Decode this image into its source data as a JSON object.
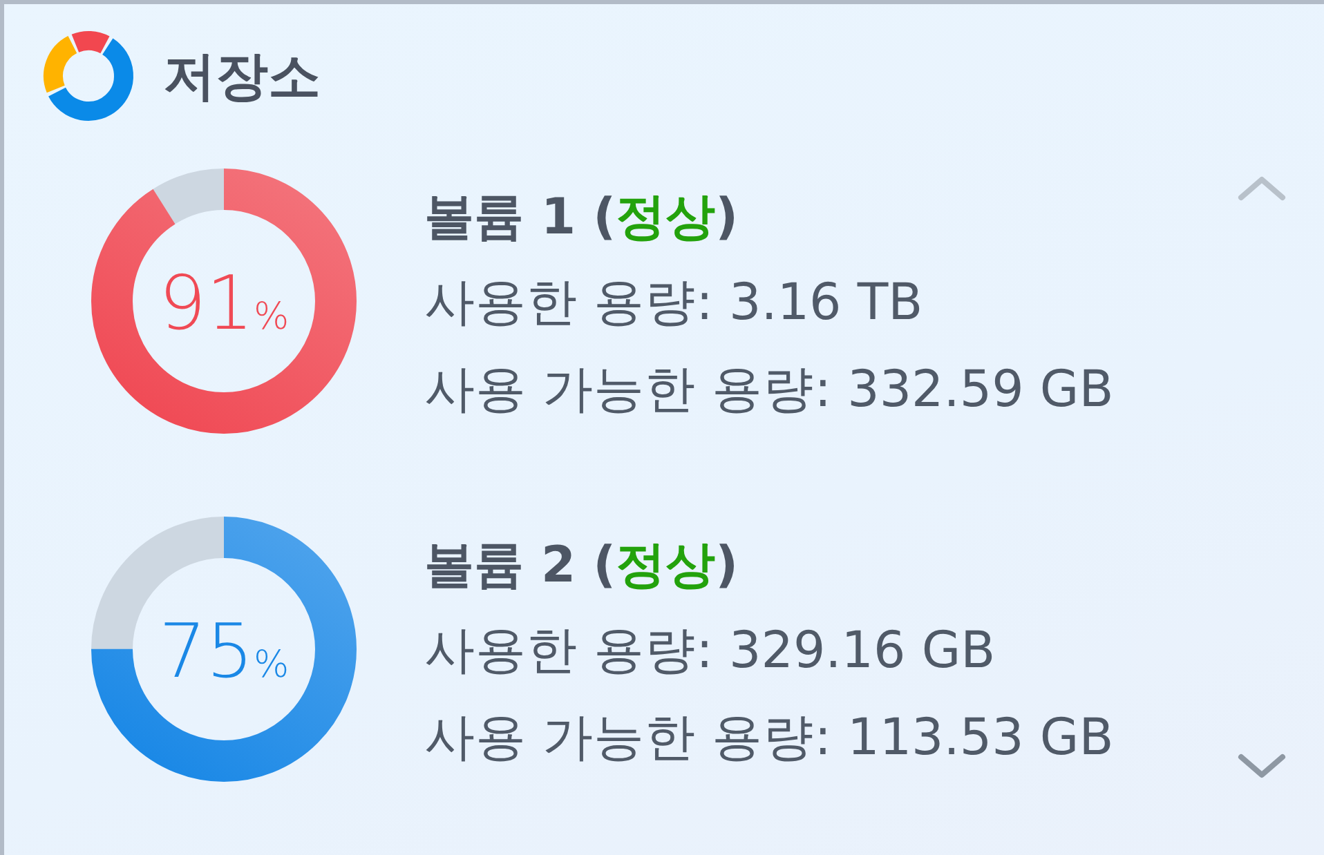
{
  "widget": {
    "title": "저장소"
  },
  "volumes": [
    {
      "name": "볼륨 1",
      "status": {
        "open": "(",
        "text": "정상",
        "close": ")"
      },
      "level": 0.91,
      "percent": "91",
      "unit": "%",
      "color": "#f04a55",
      "used": "사용한 용량: 3.16 TB",
      "available": "사용 가능한 용량: 332.59 GB"
    },
    {
      "name": "볼륨 2",
      "status": {
        "open": "(",
        "text": "정상",
        "close": ")"
      },
      "level": 0.75,
      "percent": "75",
      "unit": "%",
      "color": "#1a88e6",
      "used": "사용한 용량: 329.16 GB",
      "available": "사용 가능한 용량: 113.53 GB"
    }
  ],
  "scroll": {
    "up_disabled": true,
    "down_disabled": false
  }
}
